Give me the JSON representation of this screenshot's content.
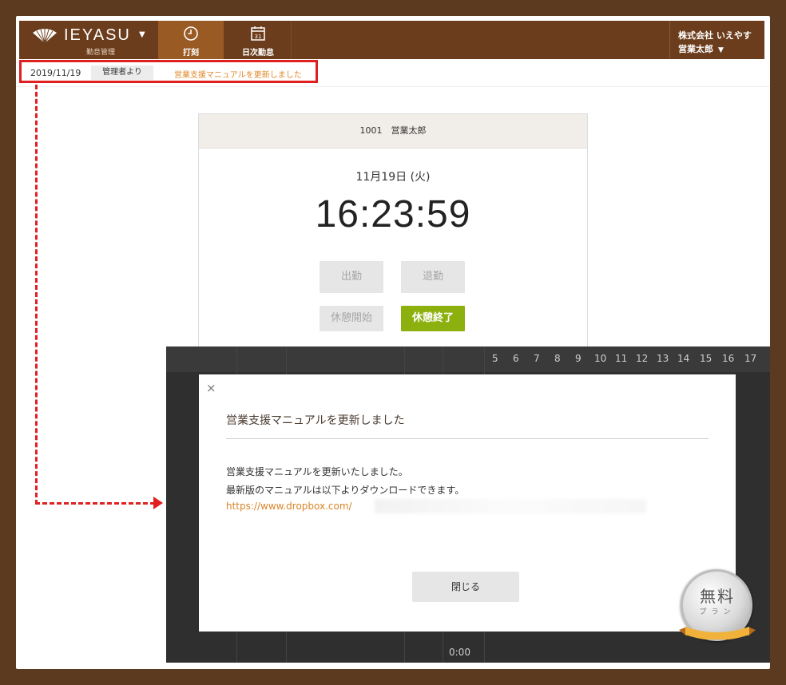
{
  "app": {
    "logo_text": "IEYASU",
    "logo_caret": "▼",
    "logo_sub": "勤怠管理"
  },
  "nav": {
    "tabs": [
      {
        "label": "打刻",
        "icon": "clock-icon"
      },
      {
        "label": "日次勤怠",
        "icon": "calendar-icon",
        "icon_text": "31"
      }
    ]
  },
  "user": {
    "company": "株式会社 いえやす",
    "name": "営業太郎",
    "caret": "▼"
  },
  "notice": {
    "date": "2019/11/19",
    "from": "管理者より",
    "message": "営業支援マニュアルを更新しました"
  },
  "card": {
    "header": "1001　営業太郎",
    "date": "11月19日 (火)",
    "time": "16:23:59",
    "buttons": {
      "clock_in": "出勤",
      "clock_out": "退勤",
      "break_start": "休憩開始",
      "break_end": "休憩終了"
    }
  },
  "background_table": {
    "days": [
      "5",
      "6",
      "7",
      "8",
      "9",
      "10",
      "11",
      "12",
      "13",
      "14",
      "15",
      "16",
      "17"
    ],
    "time": "0:00"
  },
  "modal": {
    "close": "×",
    "title": "営業支援マニュアルを更新しました",
    "line1": "営業支援マニュアルを更新いたしました。",
    "line2": "最新版のマニュアルは以下よりダウンロードできます。",
    "link": "https://www.dropbox.com/",
    "close_button": "閉じる"
  },
  "badge": {
    "main": "無料",
    "sub": "プラン"
  },
  "colors": {
    "header_brown": "#6b3d1c",
    "active_tab": "#9a5a24",
    "accent_orange": "#e08a2a",
    "break_end_green": "#8cb10f",
    "highlight_red": "#e02020"
  }
}
